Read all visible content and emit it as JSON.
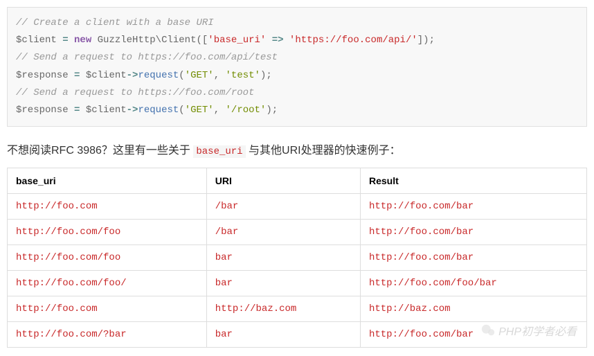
{
  "code": {
    "line1": "// Create a client with a base URI",
    "line2_var": "$client",
    "line2_eq": " = ",
    "line2_new": "new",
    "line2_type": " GuzzleHttp\\Client",
    "line2_p1": "([",
    "line2_str": "'base_uri'",
    "line2_arrow": " => ",
    "line2_url": "'https://foo.com/api/'",
    "line2_p2": "]);",
    "line3": "// Send a request to https://foo.com/api/test",
    "line4_var": "$response",
    "line4_eq": " = ",
    "line4_obj": "$client",
    "line4_op": "->",
    "line4_method": "request",
    "line4_p1": "(",
    "line4_arg1": "'GET'",
    "line4_comma": ", ",
    "line4_arg2": "'test'",
    "line4_p2": ");",
    "line5": "// Send a request to https://foo.com/root",
    "line6_var": "$response",
    "line6_eq": " = ",
    "line6_obj": "$client",
    "line6_op": "->",
    "line6_method": "request",
    "line6_p1": "(",
    "line6_arg1": "'GET'",
    "line6_comma": ", ",
    "line6_arg2": "'/root'",
    "line6_p2": ");"
  },
  "paragraph": {
    "prefix": "不想阅读RFC 3986？这里有一些关于 ",
    "inline": "base_uri",
    "suffix": " 与其他URI处理器的快速例子："
  },
  "table": {
    "headers": {
      "col1": "base_uri",
      "col2": "URI",
      "col3": "Result"
    },
    "rows": [
      {
        "c1": "http://foo.com",
        "c2": "/bar",
        "c3": "http://foo.com/bar"
      },
      {
        "c1": "http://foo.com/foo",
        "c2": "/bar",
        "c3": "http://foo.com/bar"
      },
      {
        "c1": "http://foo.com/foo",
        "c2": "bar",
        "c3": "http://foo.com/bar"
      },
      {
        "c1": "http://foo.com/foo/",
        "c2": "bar",
        "c3": "http://foo.com/foo/bar"
      },
      {
        "c1": "http://foo.com",
        "c2": "http://baz.com",
        "c3": "http://baz.com"
      },
      {
        "c1": "http://foo.com/?bar",
        "c2": "bar",
        "c3": "http://foo.com/bar"
      }
    ]
  },
  "watermark": "PHP初学者必看"
}
